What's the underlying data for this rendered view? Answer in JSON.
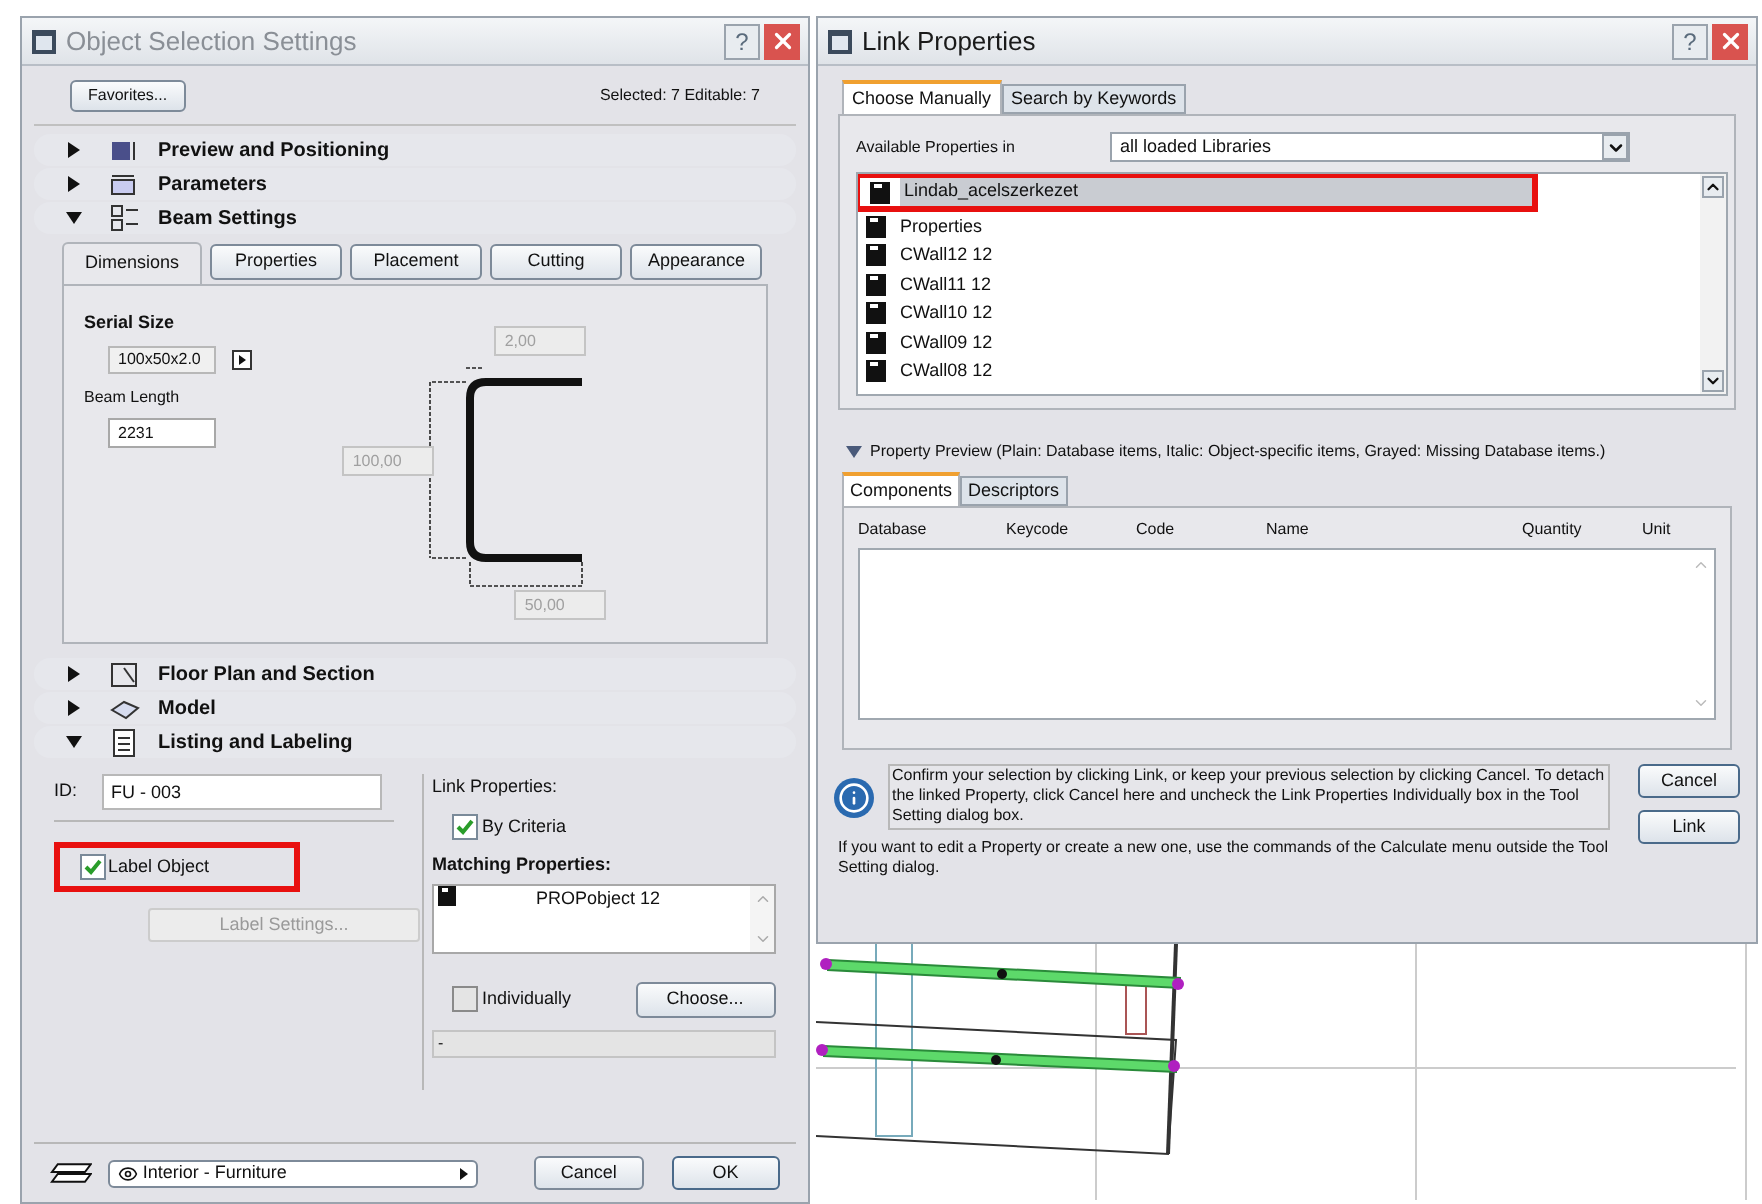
{
  "left_dialog": {
    "title": "Object Selection Settings",
    "help_button": "?",
    "favorites_button": "Favorites...",
    "selection_info": "Selected: 7 Editable: 7",
    "sections": [
      {
        "kind": "plain",
        "label": "Preview and Positioning",
        "expanded": false
      },
      {
        "kind": "plain",
        "label": "Parameters",
        "expanded": false
      },
      {
        "kind": "beam",
        "label": "Beam Settings",
        "expanded": true,
        "tabs": [
          {
            "label": "Dimensions",
            "selected": true
          },
          {
            "label": "Properties",
            "selected": false
          },
          {
            "label": "Placement",
            "selected": false
          },
          {
            "label": "Cutting",
            "selected": false
          },
          {
            "label": "Appearance",
            "selected": false
          }
        ],
        "serial_size_label": "Serial Size",
        "serial_size_value": "100x50x2.0",
        "beam_length_label": "Beam Length",
        "beam_length_value": "2231",
        "thickness_value": "2,00",
        "height_value": "100,00",
        "width_value": "50,00"
      },
      {
        "kind": "plain",
        "label": "Floor Plan and Section",
        "expanded": false
      },
      {
        "kind": "plain",
        "label": "Model",
        "expanded": false
      },
      {
        "kind": "listing",
        "label": "Listing and Labeling",
        "expanded": true,
        "id_label": "ID:",
        "id_value": "FU - 003",
        "label_object": {
          "label": "Label Object",
          "checked": true
        },
        "label_settings_button": {
          "label": "Label Settings...",
          "disabled": true
        },
        "link_properties_label": "Link Properties:",
        "by_criteria": {
          "label": "By Criteria",
          "checked": true
        },
        "matching_label": "Matching Properties:",
        "matching_items": [
          "PROPobject 12"
        ],
        "individually": {
          "label": "Individually",
          "checked": false
        },
        "choose_button": "Choose...",
        "status_value": "-"
      }
    ],
    "layer_value": "Interior - Furniture",
    "cancel_button": "Cancel",
    "ok_button": "OK"
  },
  "right_dialog": {
    "title": "Link Properties",
    "help_button": "?",
    "tabs": [
      {
        "label": "Choose Manually",
        "selected": true
      },
      {
        "label": "Search by Keywords",
        "selected": false
      }
    ],
    "available_label": "Available Properties in",
    "library_value": "all loaded Libraries",
    "properties": [
      {
        "label": "Lindab_acelszerkezet",
        "selected": true
      },
      {
        "label": "Properties",
        "selected": false
      },
      {
        "label": "CWall12 12",
        "selected": false
      },
      {
        "label": "CWall11 12",
        "selected": false
      },
      {
        "label": "CWall10 12",
        "selected": false
      },
      {
        "label": "CWall09 12",
        "selected": false
      },
      {
        "label": "CWall08 12",
        "selected": false
      }
    ],
    "preview_label": "Property Preview (Plain: Database items, Italic: Object-specific items, Grayed: Missing Database items.)",
    "preview_tabs": [
      {
        "label": "Components",
        "selected": true
      },
      {
        "label": "Descriptors",
        "selected": false
      }
    ],
    "columns": [
      "Database",
      "Keycode",
      "Code",
      "Name",
      "Quantity",
      "Unit"
    ],
    "info_text": "Confirm your selection by clicking Link, or keep your previous selection by clicking Cancel. To detach the linked Property, click Cancel here and uncheck the Link Properties Individually box in the Tool Setting dialog box.",
    "cancel_button": "Cancel",
    "link_button": "Link",
    "footer_note": "If you want to edit a Property or create a new one, use the commands of the Calculate menu outside the Tool Setting dialog."
  }
}
